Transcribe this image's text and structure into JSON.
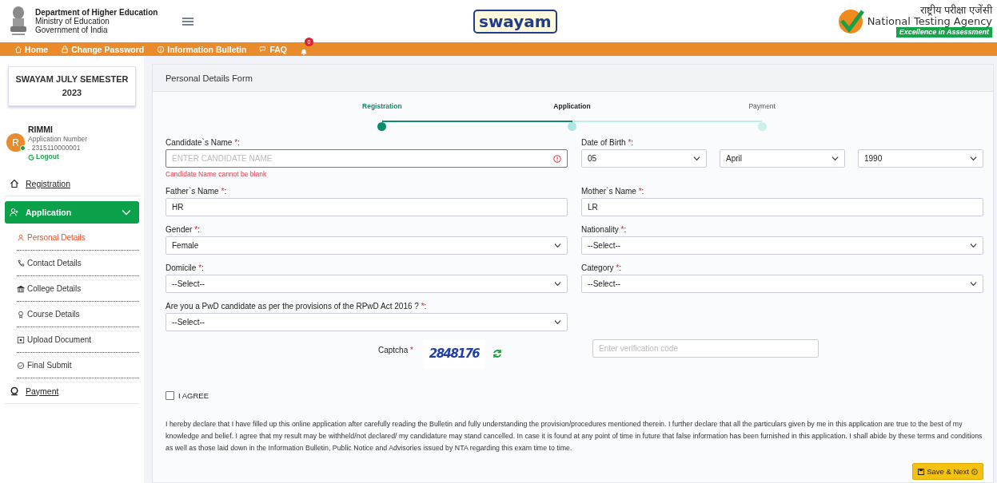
{
  "header": {
    "department": [
      "Department of Higher Education",
      "Ministry of Education",
      "Government of India"
    ],
    "logo_text": "swayam",
    "agency": {
      "hindi": "राष्ट्रीय परीक्षा एजेंसी",
      "name": "National Testing Agency",
      "tagline": "Excellence in Assessment"
    }
  },
  "nav": {
    "items": [
      {
        "kind": "home",
        "label": "Home"
      },
      {
        "kind": "lock",
        "label": "Change Password"
      },
      {
        "kind": "info",
        "label": "Information Bulletin"
      },
      {
        "kind": "chat",
        "label": "FAQ"
      }
    ],
    "notifications": "0"
  },
  "sidebar": {
    "semester": "SWAYAM JULY SEMESTER 2023",
    "user": {
      "initial": "R",
      "name": "RIMMI",
      "number_label": "Application Number",
      "number": ". 2315110000001",
      "logout": "Logout"
    },
    "menu": [
      {
        "kind": "home",
        "label": "Registration",
        "selected": false
      },
      {
        "kind": "user-plus",
        "label": "Application",
        "selected": true,
        "expanded": true,
        "children": [
          {
            "kind": "user",
            "label": "Personal Details",
            "selected": true
          },
          {
            "kind": "phone",
            "label": "Contact Details",
            "selected": false
          },
          {
            "kind": "bank",
            "label": "College Details",
            "selected": false
          },
          {
            "kind": "award",
            "label": "Course Details",
            "selected": false
          },
          {
            "kind": "upload",
            "label": "Upload Document",
            "selected": false
          },
          {
            "kind": "check",
            "label": "Final Submit",
            "selected": false
          }
        ]
      },
      {
        "kind": "payment",
        "label": "Payment",
        "selected": false
      }
    ]
  },
  "form": {
    "title": "Personal Details Form",
    "steps": [
      {
        "label": "Registration",
        "done": true,
        "selected": false
      },
      {
        "label": "Application",
        "done": false,
        "selected": true
      },
      {
        "label": "Payment",
        "done": false,
        "selected": false
      }
    ],
    "rows": [
      [
        {
          "kind": "text",
          "label": "Candidate`s Name",
          "star": "*",
          "tail": ":",
          "placeholder": "ENTER CANDIDATE NAME",
          "invalid": true,
          "error": "Candidate Name cannot be blank"
        },
        {
          "kind": "date",
          "label": "Date of Birth",
          "star": "*",
          "tail": ":",
          "parts": [
            "05",
            "April",
            "1990"
          ]
        }
      ],
      [
        {
          "kind": "text",
          "label": "Father`s Name",
          "star": "*",
          "tail": ":",
          "value": "HR",
          "invalid": false
        },
        {
          "kind": "text",
          "label": "Mother`s Name",
          "star": "*",
          "tail": ":",
          "value": "LR",
          "invalid": false
        }
      ],
      [
        {
          "kind": "select",
          "label": "Gender",
          "star": "*",
          "tail": ":",
          "value": "Female"
        },
        {
          "kind": "select",
          "label": "Nationality",
          "star": "*",
          "tail": ":",
          "value": "--Select--"
        }
      ],
      [
        {
          "kind": "select",
          "label": "Domicile",
          "star": "*",
          "tail": ":",
          "value": "--Select--"
        },
        {
          "kind": "select",
          "label": "Category",
          "star": "*",
          "tail": ":",
          "value": "--Select--"
        }
      ],
      [
        {
          "kind": "select",
          "label": "Are you a PwD candidate as per the provisions of the RPwD Act 2016 ?",
          "star": "*",
          "tail": ":",
          "value": "--Select--"
        }
      ]
    ],
    "captcha": {
      "label": "Captcha",
      "star": "*",
      "code": "2848176",
      "placeholder": "Enter verification code"
    },
    "agree": {
      "label": "I AGREE",
      "checked": false
    },
    "declaration": "I hereby declare that I have filled up this online application after carefully reading the Bulletin and fully understanding the provision/procedures mentioned therein. I further declare that all the particulars given by me in this application are true to the best of my knowledge and belief. I agree that my result may be withheld/not declared/ my candidature may stand cancelled. In case it is found at any point of time in future that false information has been furnished in this application. I shall abide by these terms and conditions as well as those laid down in the Information Bulletin, Public Notice and Advisories issued by NTA regarding this exam time to time.",
    "save": "Save & Next"
  }
}
